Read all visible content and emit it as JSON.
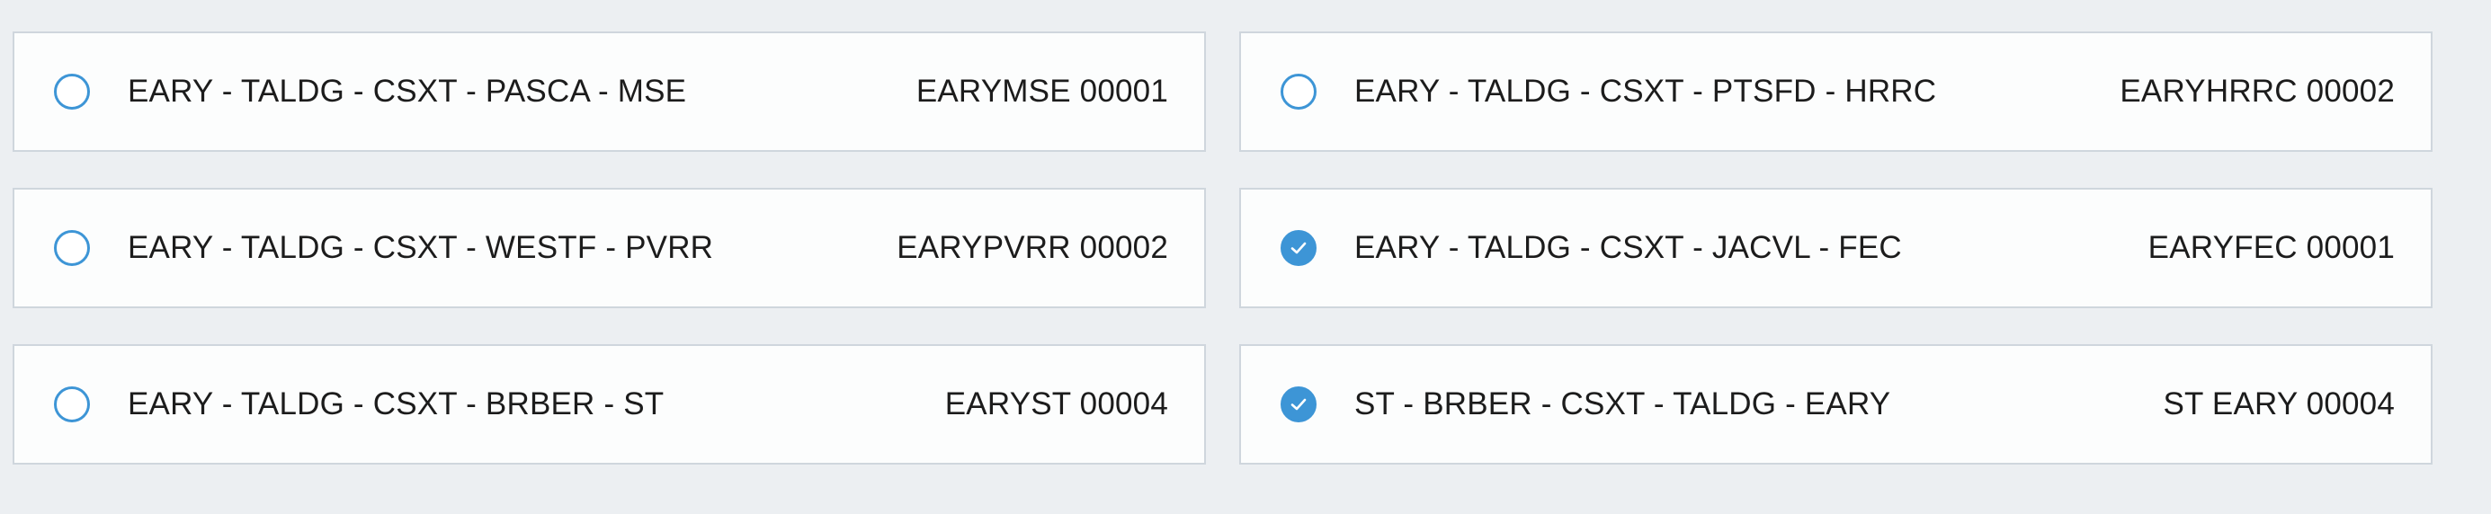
{
  "route_list": {
    "items": [
      {
        "name": "EARY - TALDG - CSXT - PASCA - MSE",
        "code": "EARYMSE 00001",
        "checked": false,
        "check_icon": "checkmark-icon"
      },
      {
        "name": "EARY - TALDG - CSXT - PTSFD - HRRC",
        "code": "EARYHRRC 00002",
        "checked": false,
        "check_icon": "checkmark-icon"
      },
      {
        "name": "EARY - TALDG - CSXT - WESTF - PVRR",
        "code": "EARYPVRR 00002",
        "checked": false,
        "check_icon": "checkmark-icon"
      },
      {
        "name": "EARY - TALDG - CSXT - JACVL - FEC",
        "code": "EARYFEC 00001",
        "checked": true,
        "check_icon": "checkmark-icon"
      },
      {
        "name": "EARY - TALDG - CSXT - BRBER - ST",
        "code": "EARYST 00004",
        "checked": false,
        "check_icon": "checkmark-icon"
      },
      {
        "name": "ST - BRBER - CSXT - TALDG - EARY",
        "code": "ST EARY 00004",
        "checked": true,
        "check_icon": "checkmark-icon"
      }
    ]
  },
  "colors": {
    "background": "#eceff2",
    "card_background": "#fcfdfd",
    "card_border": "#cfd6dd",
    "accent": "#3d95d6",
    "text": "#1c1c1c"
  }
}
